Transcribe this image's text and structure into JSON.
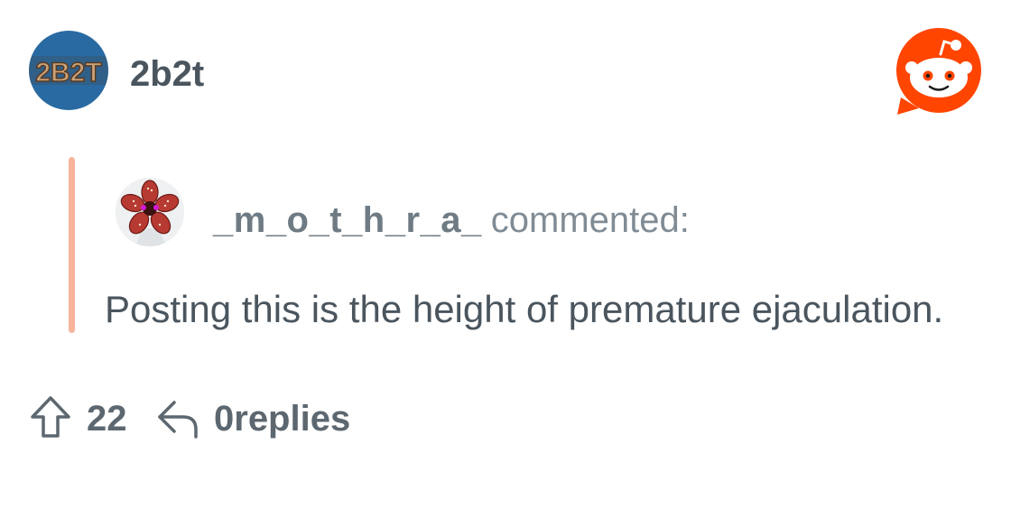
{
  "post": {
    "community_name": "2b2t",
    "community_logo_text": "2B2T"
  },
  "comment": {
    "author": "_m_o_t_h_r_a_",
    "action_label": "commented:",
    "body": "Posting this is the height of premature ejaculation."
  },
  "actions": {
    "upvotes": "22",
    "replies_label": "0replies"
  },
  "colors": {
    "quote_bar": "#f7b49a",
    "reddit_orange": "#ff4500",
    "text_primary": "#4a555e",
    "text_secondary": "#808c95"
  },
  "icons": {
    "community_avatar": "2b2t-logo",
    "brand": "reddit-snoo-icon",
    "upvote": "arrow-up-icon",
    "reply": "reply-arrow-icon",
    "commenter_avatar": "demogorgon-avatar"
  }
}
